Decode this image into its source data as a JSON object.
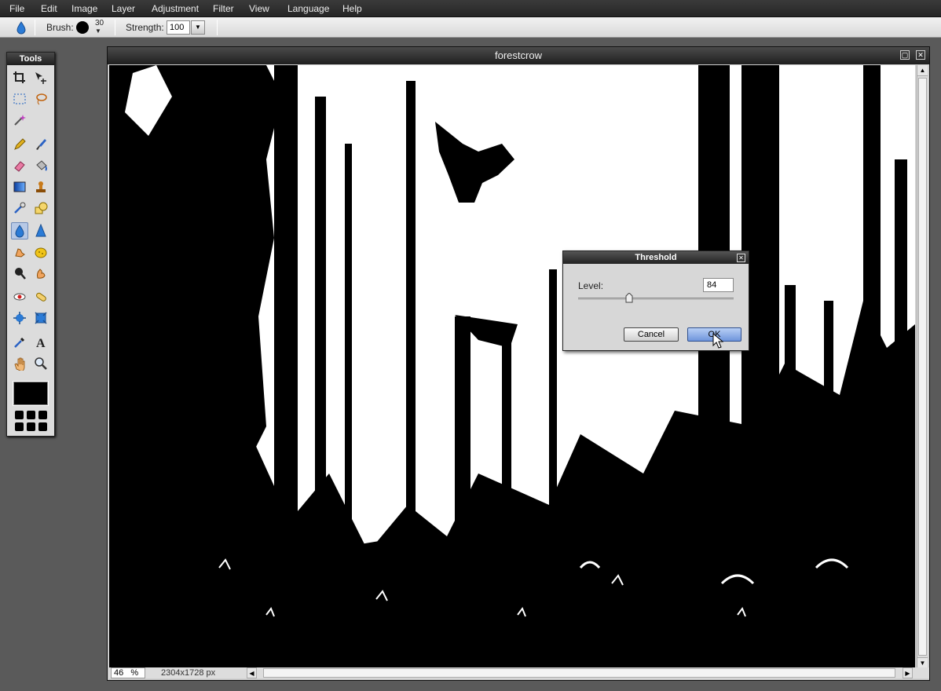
{
  "menu": [
    "File",
    "Edit",
    "Image",
    "Layer",
    "Adjustment",
    "Filter",
    "View",
    "Language",
    "Help"
  ],
  "options": {
    "brush_label": "Brush:",
    "brush_size": "30",
    "strength_label": "Strength:",
    "strength_value": "100"
  },
  "tools": {
    "title": "Tools",
    "items": [
      "crop-icon",
      "move-icon",
      "marquee-icon",
      "lasso-icon",
      "magic-wand-icon",
      "pencil-icon",
      "brush-icon",
      "eraser-icon",
      "paint-bucket-icon",
      "gradient-icon",
      "clone-stamp-icon",
      "color-replace-icon",
      "shape-icon",
      "blur-icon",
      "sharpen-icon",
      "smudge-icon",
      "sponge-icon",
      "dodge-icon",
      "burn-icon",
      "red-eye-icon",
      "spot-heal-icon",
      "bloat-icon",
      "pinch-icon",
      "color-picker-icon",
      "type-icon",
      "hand-icon",
      "zoom-icon"
    ],
    "active": "blur-icon"
  },
  "document": {
    "title": "forestcrow",
    "zoom": "46",
    "zoom_unit": "%",
    "dimensions": "2304x1728 px"
  },
  "threshold": {
    "title": "Threshold",
    "level_label": "Level:",
    "level_value": "84",
    "level_fraction": 0.33,
    "cancel_label": "Cancel",
    "ok_label": "OK"
  },
  "colors": {
    "menubar": "#2e2e2e",
    "ok_button": "#7fa3e0",
    "foreground": "#000000"
  }
}
